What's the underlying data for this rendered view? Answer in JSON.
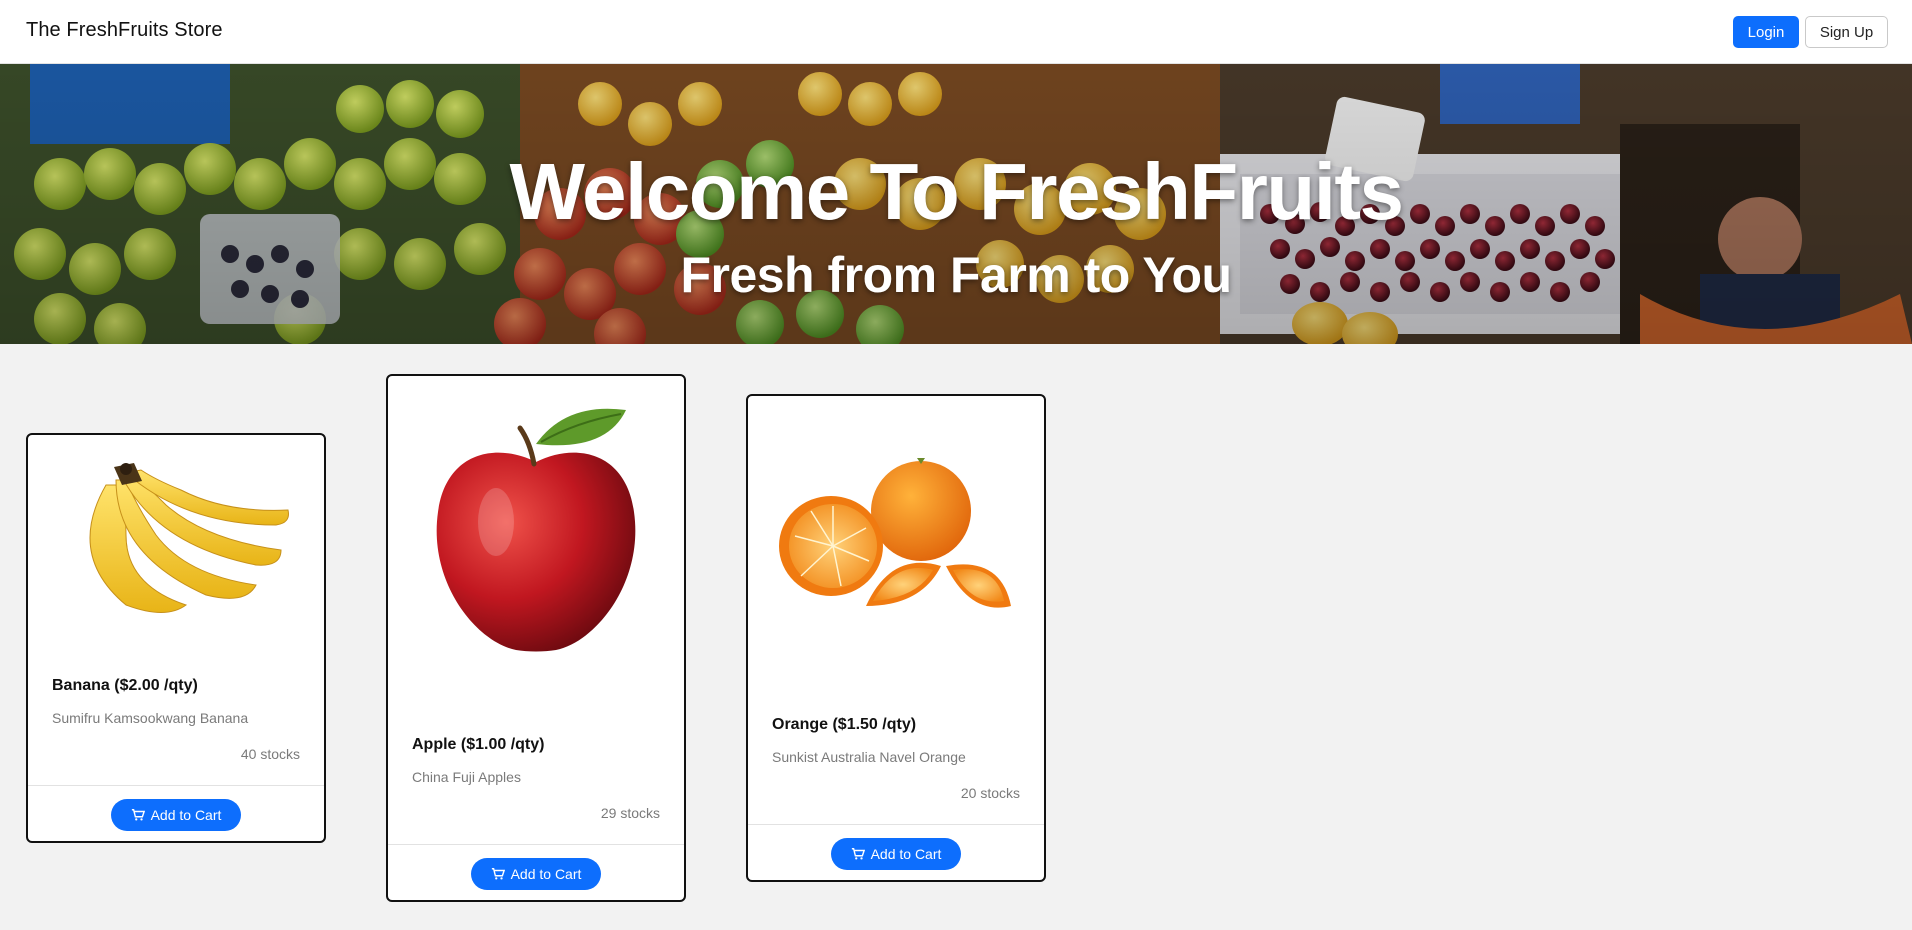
{
  "navbar": {
    "brand": "The FreshFruits Store",
    "login_label": "Login",
    "signup_label": "Sign Up"
  },
  "hero": {
    "title": "Welcome To FreshFruits",
    "subtitle": "Fresh from Farm to You"
  },
  "products": [
    {
      "title": "Banana ($2.00 /qty)",
      "description": "Sumifru Kamsookwang Banana",
      "stock": "40 stocks",
      "button_label": "Add to Cart",
      "image_icon": "banana-image"
    },
    {
      "title": "Apple ($1.00 /qty)",
      "description": "China Fuji Apples",
      "stock": "29 stocks",
      "button_label": "Add to Cart",
      "image_icon": "apple-image"
    },
    {
      "title": "Orange ($1.50 /qty)",
      "description": "Sunkist Australia Navel Orange",
      "stock": "20 stocks",
      "button_label": "Add to Cart",
      "image_icon": "orange-image"
    }
  ],
  "colors": {
    "primary": "#0d6efd",
    "page_bg": "#f2f2f2",
    "card_border": "#111111"
  }
}
